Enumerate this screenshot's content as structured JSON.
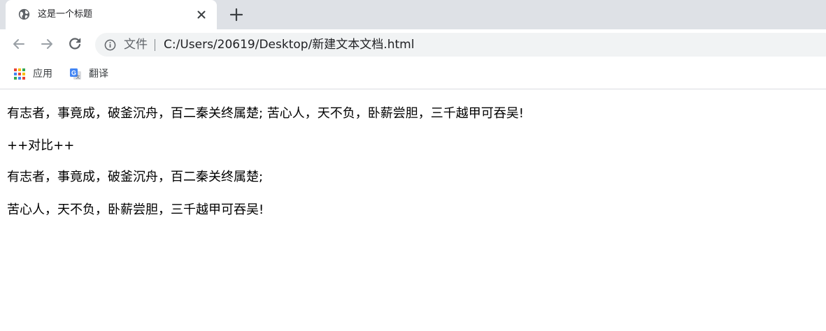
{
  "tab": {
    "title": "这是一个标题",
    "favicon": "globe-icon",
    "close_icon": "close-icon"
  },
  "toolbar": {
    "back_icon": "arrow-left-icon",
    "forward_icon": "arrow-right-icon",
    "reload_icon": "reload-icon",
    "new_tab_icon": "plus-icon"
  },
  "omnibox": {
    "security_icon": "info-icon",
    "security_label": "文件",
    "url": "C:/Users/20619/Desktop/新建文本文档.html"
  },
  "bookmarks": [
    {
      "label": "应用",
      "icon": "apps-grid-icon"
    },
    {
      "label": "翻译",
      "icon": "google-translate-icon"
    }
  ],
  "content": {
    "paragraphs": [
      "有志者，事竟成，破釜沉舟，百二秦关终属楚; 苦心人，天不负，卧薪尝胆，三千越甲可吞吴!",
      "++对比++",
      "有志者，事竟成，破釜沉舟，百二秦关终属楚;",
      "苦心人，天不负，卧薪尝胆，三千越甲可吞吴!"
    ]
  },
  "colors": {
    "tab_strip": "#dee1e6",
    "omnibox": "#f1f3f4",
    "icon": "#5f6368",
    "text": "#202124"
  }
}
